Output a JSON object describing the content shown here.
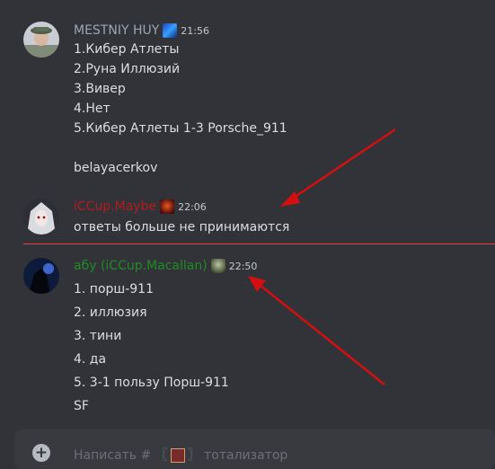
{
  "messages": [
    {
      "author": "MESTNIY HUY",
      "author_color": "#9aa6b6",
      "time": "21:56",
      "lines": [
        "1.Кибер Атлеты",
        "2.Руна Иллюзий",
        "3.Вивер",
        "4.Нет",
        "5.Кибер Атлеты 1-3 Porsche_911",
        "",
        "belayacerkov"
      ]
    },
    {
      "author": "iCCup.Maybe",
      "author_color": "#b51b1b",
      "time": "22:06",
      "lines": [
        "ответы больше не принимаются"
      ]
    },
    {
      "author": "абу (iCCup.Macallan)",
      "author_color": "#1f8b24",
      "time": "22:50",
      "lines": [
        "1. порш-911",
        "2. иллюзия",
        "3. тини",
        "4. да",
        "5. 3-1 пользу Порш-911",
        "SF"
      ]
    }
  ],
  "composer": {
    "placeholder_prefix": "Написать #",
    "placeholder_channel": "тотализатор"
  },
  "colors": {
    "background": "#313338",
    "divider": "#f23f43",
    "arrow": "#d40f0f"
  }
}
